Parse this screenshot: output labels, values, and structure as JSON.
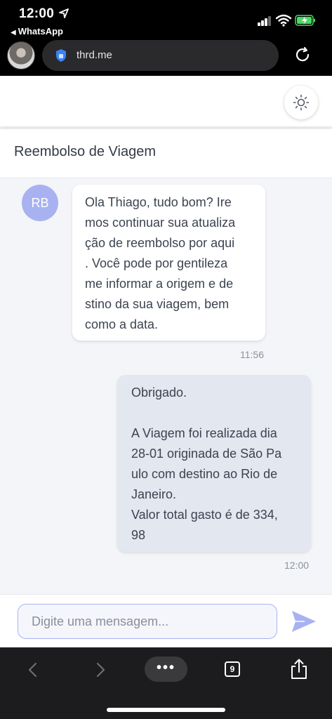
{
  "status_bar": {
    "time": "12:00",
    "back_app": "WhatsApp"
  },
  "browser": {
    "url": "thrd.me",
    "tab_count": "9",
    "more_label": "•••"
  },
  "chat": {
    "title": "Reembolso de Viagem",
    "bot_initials": "RB",
    "messages": [
      {
        "from": "bot",
        "text": "Ola Thiago, tudo bom? Ire\nmos continuar sua atualiza\nção de reembolso por aqui\n. Você pode por gentileza\nme informar a origem e de\nstino da sua viagem, bem\ncomo a data.",
        "time": "11:56"
      },
      {
        "from": "user",
        "text": "Obrigado.\n\nA Viagem foi realizada dia\n28-01 originada de São Pa\nulo com destino ao Rio de\nJaneiro.\nValor total gasto é de 334,\n98",
        "time": "12:00"
      }
    ],
    "input_placeholder": "Digite uma mensagem..."
  },
  "colors": {
    "accent": "#a9b2f0",
    "user_bubble": "#e2e7f0",
    "background": "#f4f5f8"
  },
  "icons": [
    "location-arrow-icon",
    "signal-icon",
    "wifi-icon",
    "battery-charging-icon",
    "shield-icon",
    "reload-icon",
    "sun-icon",
    "send-icon",
    "back-icon",
    "forward-icon",
    "tabs-icon",
    "share-icon"
  ]
}
